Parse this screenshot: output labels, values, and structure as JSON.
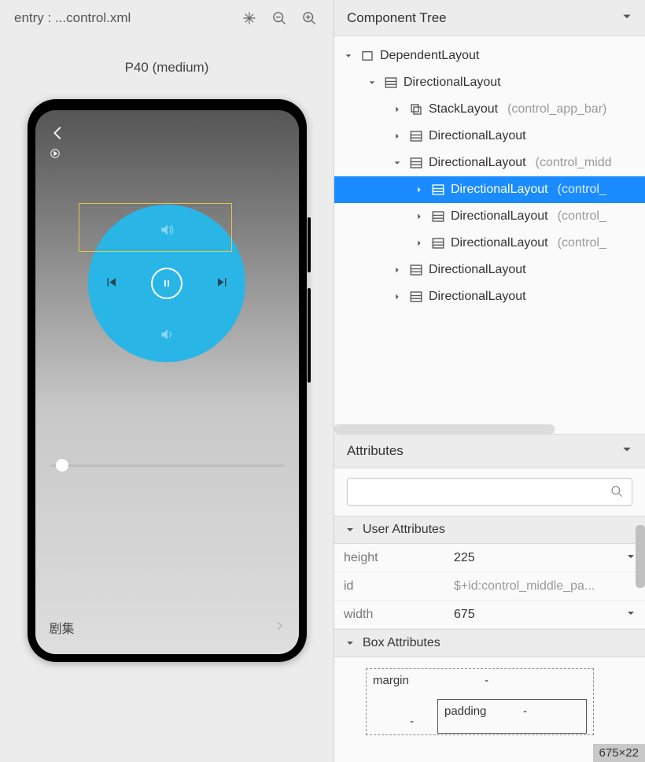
{
  "left": {
    "title": "entry : ...control.xml",
    "device": "P40 (medium)",
    "episodes": "剧集"
  },
  "tree": {
    "title": "Component Tree",
    "nodes": [
      {
        "indent": 0,
        "expand": "down",
        "icon": "dependent",
        "label": "DependentLayout",
        "meta": "",
        "selected": false
      },
      {
        "indent": 1,
        "expand": "down",
        "icon": "layout",
        "label": "DirectionalLayout",
        "meta": "",
        "selected": false
      },
      {
        "indent": 2,
        "expand": "right",
        "icon": "stack",
        "label": "StackLayout",
        "meta": "(control_app_bar)",
        "selected": false
      },
      {
        "indent": 2,
        "expand": "right",
        "icon": "layout",
        "label": "DirectionalLayout",
        "meta": "",
        "selected": false
      },
      {
        "indent": 2,
        "expand": "down",
        "icon": "layout",
        "label": "DirectionalLayout",
        "meta": "(control_midd",
        "selected": false
      },
      {
        "indent": 3,
        "expand": "right",
        "icon": "layout",
        "label": "DirectionalLayout",
        "meta": "(control_",
        "selected": true
      },
      {
        "indent": 3,
        "expand": "right",
        "icon": "layout",
        "label": "DirectionalLayout",
        "meta": "(control_",
        "selected": false
      },
      {
        "indent": 3,
        "expand": "right",
        "icon": "layout",
        "label": "DirectionalLayout",
        "meta": "(control_",
        "selected": false
      },
      {
        "indent": 2,
        "expand": "right",
        "icon": "layout",
        "label": "DirectionalLayout",
        "meta": "",
        "selected": false
      },
      {
        "indent": 2,
        "expand": "right",
        "icon": "layout",
        "label": "DirectionalLayout",
        "meta": "",
        "selected": false
      }
    ]
  },
  "attributes": {
    "title": "Attributes",
    "user_section": "User Attributes",
    "box_section": "Box Attributes",
    "rows": [
      {
        "key": "height",
        "value": "225",
        "muted": false,
        "dd": true
      },
      {
        "key": "id",
        "value": "$+id:control_middle_pa...",
        "muted": true,
        "dd": false
      },
      {
        "key": "width",
        "value": "675",
        "muted": false,
        "dd": true
      }
    ],
    "box": {
      "margin_label": "margin",
      "padding_label": "padding",
      "dash": "-"
    },
    "dims": "675×22"
  }
}
